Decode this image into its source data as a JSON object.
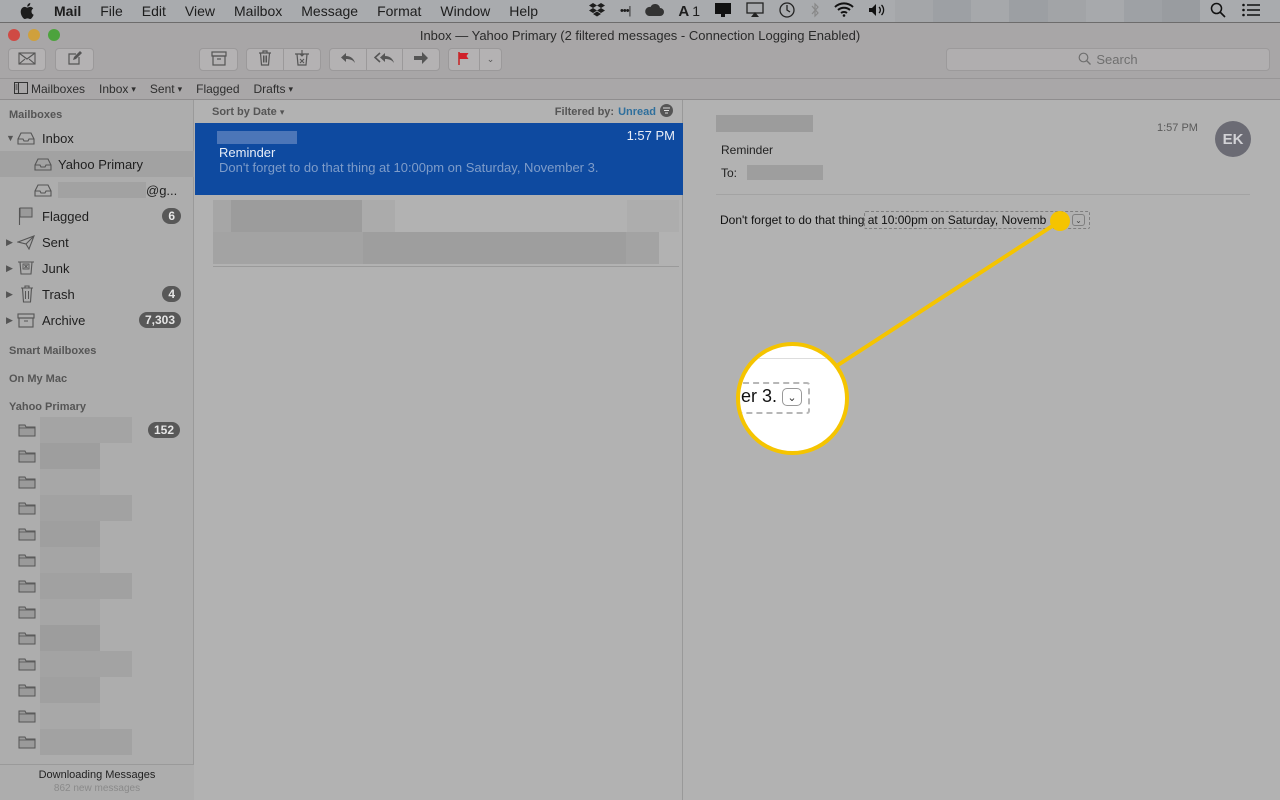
{
  "menubar": {
    "apple_icon": "apple-logo",
    "app_name": "Mail",
    "items": [
      "File",
      "Edit",
      "View",
      "Mailbox",
      "Message",
      "Format",
      "Window",
      "Help"
    ],
    "status_icons": [
      "dropbox-icon",
      "signal-dots-icon",
      "cloud-icon",
      "adobe-icon",
      "display-icon",
      "airplay-icon",
      "time-machine-icon",
      "bluetooth-icon",
      "wifi-icon",
      "volume-icon"
    ],
    "adobe_count": "1",
    "right_icons": [
      "spotlight-search-icon",
      "notification-center-icon"
    ]
  },
  "window": {
    "title": "Inbox — Yahoo Primary (2 filtered messages - Connection Logging Enabled)",
    "toolbar": {
      "get_mail": "envelope-icon",
      "compose": "compose-icon",
      "archive": "archive-icon",
      "delete": "trash-icon",
      "junk": "junk-icon",
      "reply": "reply-icon",
      "reply_all": "reply-all-icon",
      "forward": "forward-icon",
      "flag": "flag-icon",
      "flag_color": "#d0202a",
      "flag_menu": "chevron-down-icon"
    },
    "search_placeholder": "Search"
  },
  "favorites": [
    {
      "label": "Mailboxes",
      "icon": "sidebar-icon"
    },
    {
      "label": "Inbox",
      "chevron": true
    },
    {
      "label": "Sent",
      "chevron": true
    },
    {
      "label": "Flagged"
    },
    {
      "label": "Drafts",
      "chevron": true
    }
  ],
  "sidebar": {
    "mailboxes_header": "Mailboxes",
    "items": [
      {
        "label": "Inbox",
        "expanded": true
      },
      {
        "label": "Yahoo Primary",
        "selected": true
      },
      {
        "label": "@g...",
        "redacted": true
      },
      {
        "label": "Flagged",
        "badge": "6"
      },
      {
        "label": "Sent"
      },
      {
        "label": "Junk"
      },
      {
        "label": "Trash",
        "badge": "4"
      },
      {
        "label": "Archive",
        "badge": "7,303"
      }
    ],
    "smart_mailboxes_header": "Smart Mailboxes",
    "on_my_mac_header": "On My Mac",
    "account_header": "Yahoo Primary",
    "account_first_badge": "152",
    "footer": {
      "title": "Downloading Messages",
      "subtitle": "862 new messages"
    }
  },
  "message_list": {
    "sort_label": "Sort by Date",
    "filter_label": "Filtered by:",
    "filter_value": "Unread",
    "selected": {
      "time": "1:57 PM",
      "subject": "Reminder",
      "preview": "Don't forget to do that thing at 10:00pm on Saturday, November 3."
    }
  },
  "reader": {
    "time": "1:57 PM",
    "avatar_initials": "EK",
    "subject": "Reminder",
    "to_label": "To:",
    "body_prefix": "Don't forget to do that thing ",
    "body_date": "at 10:00pm on Saturday, Novemb",
    "callout_text": "er 3."
  },
  "colors": {
    "selection": "#0e4aa0",
    "callout": "#f5c400",
    "unread_link": "#2f6f9c"
  }
}
